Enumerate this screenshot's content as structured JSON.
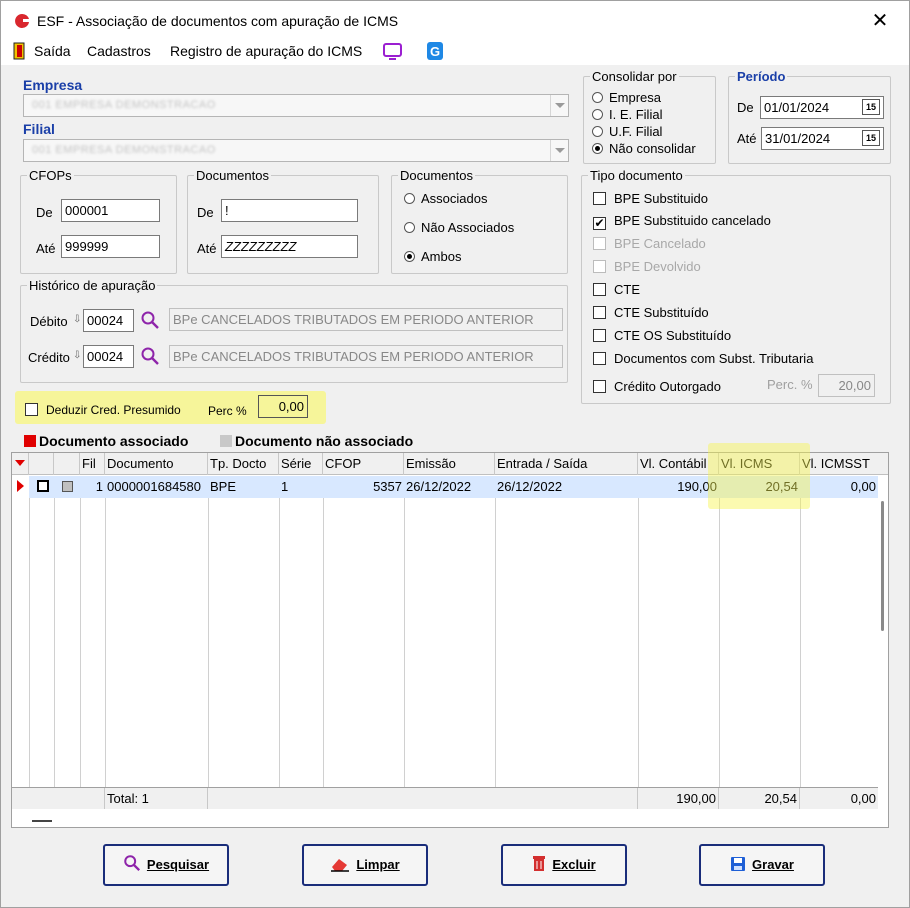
{
  "window": {
    "title": "ESF - Associação de documentos com apuração de ICMS",
    "close_glyph": "✕"
  },
  "menu": {
    "items": [
      "Saída",
      "Cadastros",
      "Registro de apuração do ICMS"
    ]
  },
  "empresa": {
    "label": "Empresa",
    "value": "001 EMPRESA DEMONSTRACAO"
  },
  "filial": {
    "label": "Filial",
    "value": "001 EMPRESA DEMONSTRACAO"
  },
  "consolidar": {
    "legend": "Consolidar por",
    "options": [
      "Empresa",
      "I. E. Filial",
      "U.F. Filial",
      "Não consolidar"
    ],
    "selected": "Não consolidar"
  },
  "periodo": {
    "legend": "Período",
    "de_label": "De",
    "de_value": "01/01/2024",
    "ate_label": "Até",
    "ate_value": "31/01/2024",
    "cal_glyph": "15"
  },
  "cfops": {
    "legend": "CFOPs",
    "de_label": "De",
    "de_value": "000001",
    "ate_label": "Até",
    "ate_value": "999999"
  },
  "documentos_range": {
    "legend": "Documentos",
    "de_label": "De",
    "de_value": "!",
    "ate_label": "Até",
    "ate_value": "ZZZZZZZZZ"
  },
  "documentos_filter": {
    "legend": "Documentos",
    "options": [
      "Associados",
      "Não Associados",
      "Ambos"
    ],
    "selected": "Ambos"
  },
  "historico": {
    "legend": "Histórico de apuração",
    "debito_label": "Débito",
    "debito_code": "00024",
    "debito_desc": "BPe CANCELADOS TRIBUTADOS EM PERIODO ANTERIOR",
    "credito_label": "Crédito",
    "credito_code": "00024",
    "credito_desc": "BPe CANCELADOS TRIBUTADOS EM PERIODO ANTERIOR"
  },
  "tipo_documento": {
    "legend": "Tipo documento",
    "items": [
      {
        "label": "BPE Substituido",
        "checked": false,
        "enabled": true
      },
      {
        "label": "BPE Substituido cancelado",
        "checked": true,
        "enabled": true
      },
      {
        "label": "BPE Cancelado",
        "checked": false,
        "enabled": false
      },
      {
        "label": "BPE Devolvido",
        "checked": false,
        "enabled": false
      },
      {
        "label": "CTE",
        "checked": false,
        "enabled": true
      },
      {
        "label": "CTE Substituído",
        "checked": false,
        "enabled": true
      },
      {
        "label": "CTE OS Substituído",
        "checked": false,
        "enabled": true
      },
      {
        "label": "Documentos com Subst. Tributaria",
        "checked": false,
        "enabled": true
      },
      {
        "label": "Crédito Outorgado",
        "checked": false,
        "enabled": true
      }
    ],
    "perc_label": "Perc. %",
    "perc_value": "20,00"
  },
  "deduzir": {
    "label": "Deduzir Cred. Presumido",
    "perc_label": "Perc %",
    "perc_value": "0,00"
  },
  "legend_bar": {
    "associado": "Documento associado",
    "associado_color": "#e00000",
    "nao_associado": "Documento não associado",
    "nao_associado_color": "#c8c8c8"
  },
  "table": {
    "columns": [
      "Fil",
      "Documento",
      "Tp. Docto",
      "Série",
      "CFOP",
      "Emissão",
      "Entrada / Saída",
      "Vl. Contábil",
      "Vl. ICMS",
      "Vl. ICMSST"
    ],
    "rows": [
      {
        "fil": "1",
        "documento": "0000001684580",
        "tp_docto": "BPE",
        "serie": "1",
        "cfop": "5357",
        "emissao": "26/12/2022",
        "entrada_saida": "26/12/2022",
        "vl_contabil": "190,00",
        "vl_icms": "20,54",
        "vl_icmsst": "0,00"
      }
    ],
    "total_label": "Total: 1",
    "total_contabil": "190,00",
    "total_icms": "20,54",
    "total_icmsst": "0,00"
  },
  "buttons": {
    "pesquisar": "Pesquisar",
    "limpar": "Limpar",
    "excluir": "Excluir",
    "gravar": "Gravar"
  },
  "colors": {
    "accent_blue": "#1a3fa8",
    "highlight": "#f6f59a",
    "selected_row": "#d8e8ff",
    "brand_red": "#d9272e"
  }
}
